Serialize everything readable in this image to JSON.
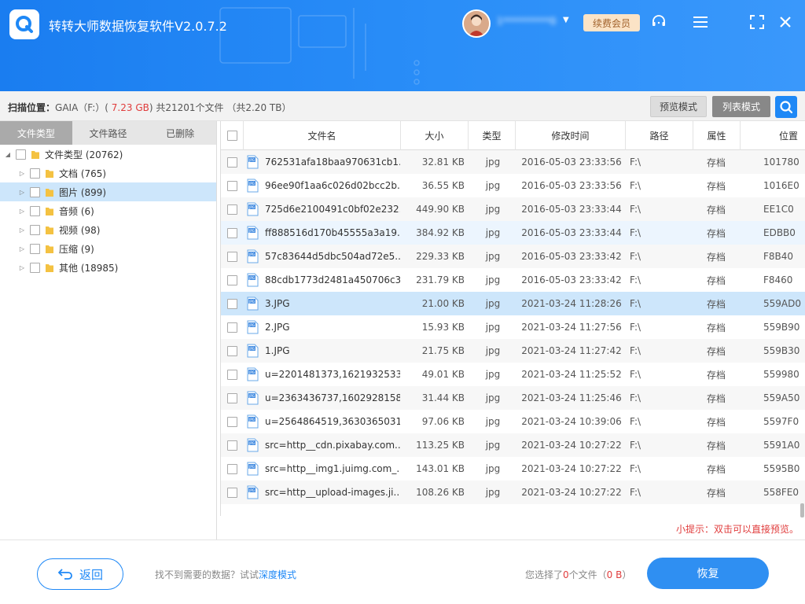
{
  "header": {
    "title": "转转大师数据恢复软件V2.0.7.2",
    "username": "1**********0",
    "renew_label": "续费会员",
    "icons": [
      "headset-icon",
      "menu-icon",
      "maximize-icon",
      "close-icon"
    ]
  },
  "scan": {
    "label": "扫描位置：",
    "drive": "GAIA（F:）(",
    "size": "7.23 GB",
    "rest": ")   共21201个文件 （共2.20 TB）",
    "preview_mode": "预览模式",
    "list_mode": "列表模式"
  },
  "left": {
    "tabs": [
      "文件类型",
      "文件路径",
      "已删除"
    ],
    "tree": [
      {
        "label": "文件类型 (20762)",
        "level": 0,
        "selected": false
      },
      {
        "label": "文档 (765)",
        "level": 1,
        "selected": false
      },
      {
        "label": "图片 (899)",
        "level": 1,
        "selected": true
      },
      {
        "label": "音频 (6)",
        "level": 1,
        "selected": false
      },
      {
        "label": "视频 (98)",
        "level": 1,
        "selected": false
      },
      {
        "label": "压缩 (9)",
        "level": 1,
        "selected": false
      },
      {
        "label": "其他 (18985)",
        "level": 1,
        "selected": false
      }
    ]
  },
  "table": {
    "columns": [
      "文件名",
      "大小",
      "类型",
      "修改时间",
      "路径",
      "属性",
      "位置"
    ],
    "rows": [
      {
        "name": "762531afa18baa970631cb1...",
        "size": "32.81 KB",
        "type": "jpg",
        "time": "2016-05-03 23:33:56",
        "path": "F:\\",
        "attr": "存档",
        "pos": "101780"
      },
      {
        "name": "96ee90f1aa6c026d02bcc2b...",
        "size": "36.55 KB",
        "type": "jpg",
        "time": "2016-05-03 23:33:56",
        "path": "F:\\",
        "attr": "存档",
        "pos": "1016E0"
      },
      {
        "name": "725d6e2100491c0bf02e232...",
        "size": "449.90 KB",
        "type": "jpg",
        "time": "2016-05-03 23:33:44",
        "path": "F:\\",
        "attr": "存档",
        "pos": "EE1C0"
      },
      {
        "name": "ff888516d170b45555a3a19...",
        "size": "384.92 KB",
        "type": "jpg",
        "time": "2016-05-03 23:33:44",
        "path": "F:\\",
        "attr": "存档",
        "pos": "EDBB0"
      },
      {
        "name": "57c83644d5dbc504ad72e5...",
        "size": "229.33 KB",
        "type": "jpg",
        "time": "2016-05-03 23:33:42",
        "path": "F:\\",
        "attr": "存档",
        "pos": "F8B40"
      },
      {
        "name": "88cdb1773d2481a450706c3...",
        "size": "231.79 KB",
        "type": "jpg",
        "time": "2016-05-03 23:33:42",
        "path": "F:\\",
        "attr": "存档",
        "pos": "F8460"
      },
      {
        "name": "3.JPG",
        "size": "21.00 KB",
        "type": "jpg",
        "time": "2021-03-24 11:28:26",
        "path": "F:\\",
        "attr": "存档",
        "pos": "559AD0"
      },
      {
        "name": "2.JPG",
        "size": "15.93 KB",
        "type": "jpg",
        "time": "2021-03-24 11:27:56",
        "path": "F:\\",
        "attr": "存档",
        "pos": "559B90"
      },
      {
        "name": "1.JPG",
        "size": "21.75 KB",
        "type": "jpg",
        "time": "2021-03-24 11:27:42",
        "path": "F:\\",
        "attr": "存档",
        "pos": "559B30"
      },
      {
        "name": "u=2201481373,1621932533,...",
        "size": "49.01 KB",
        "type": "jpg",
        "time": "2021-03-24 11:25:52",
        "path": "F:\\",
        "attr": "存档",
        "pos": "559980"
      },
      {
        "name": "u=2363436737,1602928158,...",
        "size": "31.44 KB",
        "type": "jpg",
        "time": "2021-03-24 11:25:46",
        "path": "F:\\",
        "attr": "存档",
        "pos": "559A50"
      },
      {
        "name": "u=2564864519,3630365031,...",
        "size": "97.06 KB",
        "type": "jpg",
        "time": "2021-03-24 10:39:06",
        "path": "F:\\",
        "attr": "存档",
        "pos": "5597F0"
      },
      {
        "name": "src=http__cdn.pixabay.com...",
        "size": "113.25 KB",
        "type": "jpg",
        "time": "2021-03-24 10:27:22",
        "path": "F:\\",
        "attr": "存档",
        "pos": "5591A0"
      },
      {
        "name": "src=http__img1.juimg.com_...",
        "size": "143.01 KB",
        "type": "jpg",
        "time": "2021-03-24 10:27:22",
        "path": "F:\\",
        "attr": "存档",
        "pos": "5595B0"
      },
      {
        "name": "src=http__upload-images.ji...",
        "size": "108.26 KB",
        "type": "jpg",
        "time": "2021-03-24 10:27:22",
        "path": "F:\\",
        "attr": "存档",
        "pos": "558FE0"
      }
    ]
  },
  "tip": "小提示：双击可以直接预览。",
  "footer": {
    "back_label": "返回",
    "hint_text": "找不到需要的数据？试试",
    "hint_link": "深度模式",
    "selected_pre": "您选择了",
    "selected_count": "0",
    "selected_mid": "个文件（",
    "selected_size": "0 B",
    "selected_post": "）",
    "recover_label": "恢复"
  },
  "colors": {
    "header_blue": "#2a8ef8",
    "accent": "#1e88f6",
    "warning_red": "#e03c3c",
    "selected_row": "#cde6fb"
  }
}
